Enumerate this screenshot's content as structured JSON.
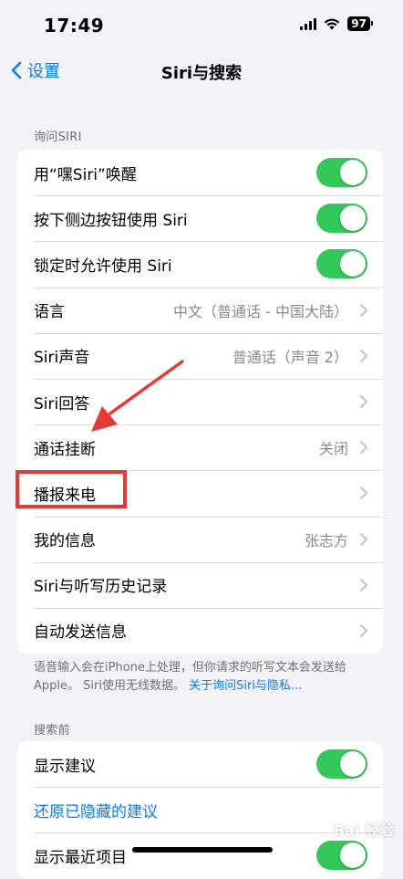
{
  "status_bar": {
    "time": "17:49",
    "battery": "97"
  },
  "nav": {
    "back_label": "设置",
    "title": "Siri与搜索"
  },
  "ask_siri": {
    "header": "询问SIRI",
    "rows": [
      {
        "label": "用“嘿Siri”唤醒",
        "toggle": true
      },
      {
        "label": "按下侧边按钮使用 Siri",
        "toggle": true
      },
      {
        "label": "锁定时允许使用 Siri",
        "toggle": true
      },
      {
        "label": "语言",
        "value": "中文（普通话 - 中国大陆）"
      },
      {
        "label": "Siri声音",
        "value": "普通话（声音 2）"
      },
      {
        "label": "Siri回答",
        "value": ""
      },
      {
        "label": "通话挂断",
        "value": "关闭"
      },
      {
        "label": "播报来电",
        "value": ""
      },
      {
        "label": "我的信息",
        "value": "张志方"
      },
      {
        "label": "Siri与听写历史记录",
        "value": ""
      },
      {
        "label": "自动发送信息",
        "value": ""
      }
    ],
    "footer_text": "语音输入会在iPhone上处理，但你请求的听写文本会发送给 Apple。 Siri使用无线数据。",
    "footer_link": "关于询问Siri与隐私..."
  },
  "before_search": {
    "header": "搜索前",
    "rows": [
      {
        "label": "显示建议",
        "toggle": true
      },
      {
        "label": "还原已隐藏的建议"
      },
      {
        "label": "显示最近项目",
        "toggle": true
      }
    ]
  },
  "watermark": "Bai 经验",
  "colors": {
    "accent": "#0a7aff",
    "toggle_on": "#34c759",
    "annotation": "#e53935"
  }
}
